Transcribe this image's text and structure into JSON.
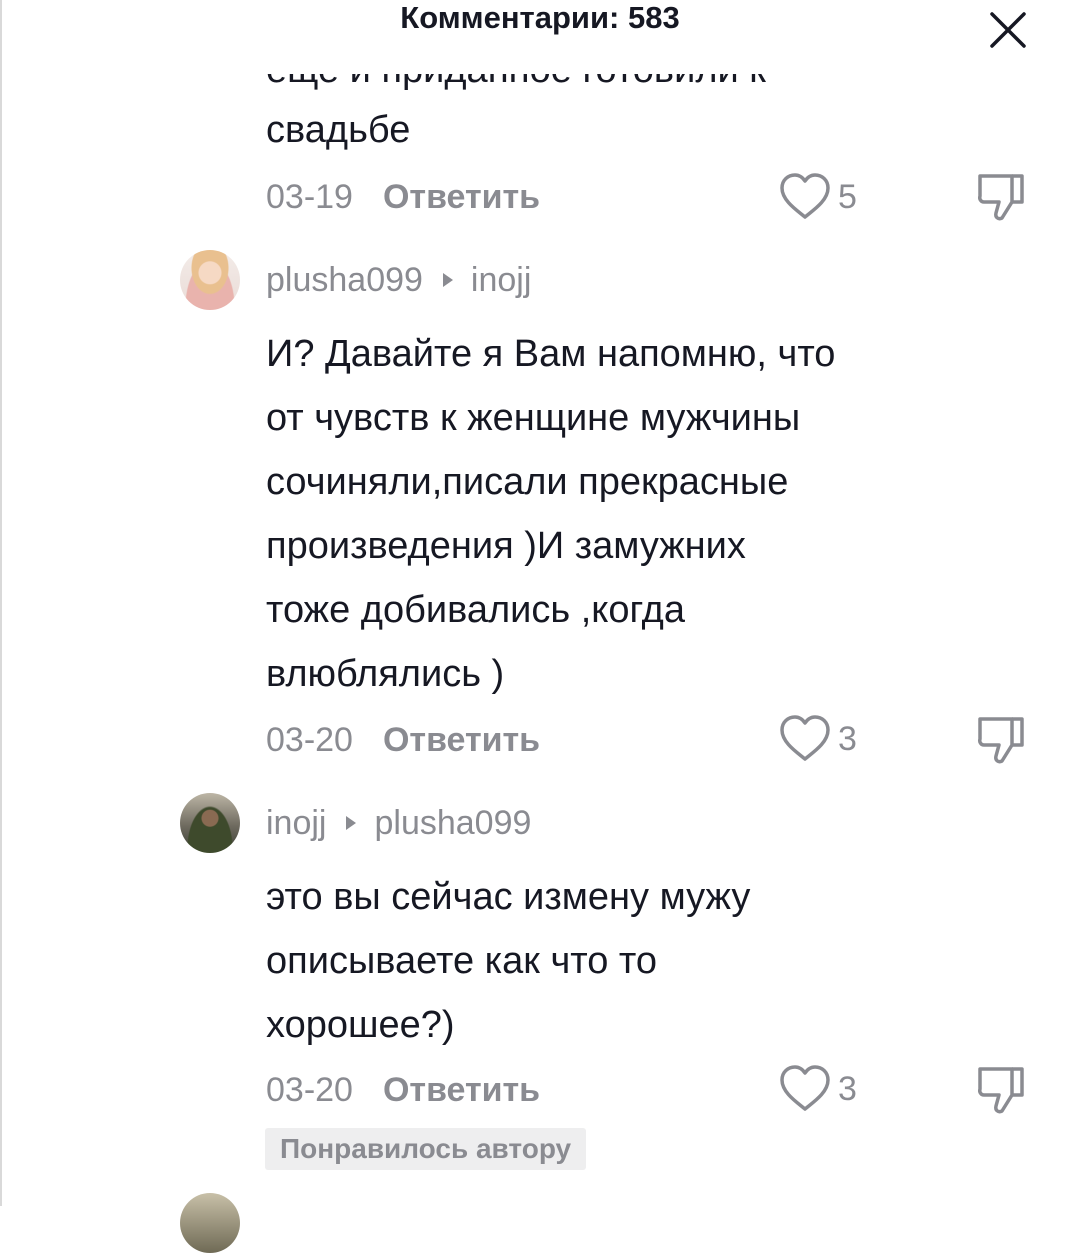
{
  "header": {
    "title": "Комментарии: 583"
  },
  "comments": [
    {
      "cut_line": "еще и приданное готовили к",
      "lines": [
        "свадьбе"
      ],
      "date": "03-19",
      "reply_label": "Ответить",
      "likes": "5"
    },
    {
      "username": "plusha099",
      "reply_to": "inojj",
      "lines": [
        "И? Давайте я Вам напомню, что",
        "от чувств к женщине мужчины",
        "сочиняли,писали прекрасные",
        "произведения )И замужних",
        "тоже добивались ,когда",
        "влюблялись )"
      ],
      "date": "03-20",
      "reply_label": "Ответить",
      "likes": "3"
    },
    {
      "username": "inojj",
      "reply_to": "plusha099",
      "lines": [
        "это вы сейчас измену мужу",
        "описываете как что то",
        "хорошее?)"
      ],
      "date": "03-20",
      "reply_label": "Ответить",
      "likes": "3",
      "badge": "Понравилось автору"
    }
  ],
  "icons": {
    "close": "close-icon",
    "like": "heart-outline-icon",
    "dislike": "thumbs-down-icon"
  },
  "colors": {
    "text_primary": "#161823",
    "text_secondary": "#8a8b91",
    "badge_bg": "#eeeeef"
  }
}
